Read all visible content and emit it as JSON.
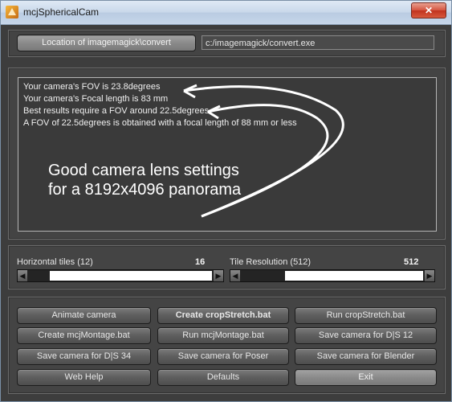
{
  "window": {
    "title": "mcjSphericalCam",
    "close_label": "✕"
  },
  "convert": {
    "button_label": "Location of imagemagick\\convert",
    "path_value": "c:/imagemagick/convert.exe"
  },
  "info": {
    "lines": [
      "Your camera's FOV is 23.8degrees",
      "Your camera's Focal length is 83 mm",
      "Best results require a FOV around 22.5degrees",
      " A FOV of 22.5degrees is obtained with a focal length of 88 mm or less"
    ],
    "annotation": [
      "Good camera lens settings",
      "for a 8192x4096 panorama"
    ]
  },
  "sliders": {
    "horizontal_tiles": {
      "label": "Horizontal tiles (12)",
      "value": "16",
      "fraction": 0.12
    },
    "tile_resolution": {
      "label": "Tile Resolution (512)",
      "value": "512",
      "fraction": 0.25
    }
  },
  "buttons": {
    "animate": "Animate camera",
    "create_crop": "Create cropStretch.bat",
    "run_crop": "Run cropStretch.bat",
    "create_montage": "Create mcjMontage.bat",
    "run_montage": "Run mcjMontage.bat",
    "save_ds12": "Save camera for D|S 12",
    "save_ds34": "Save camera for D|S 34",
    "save_poser": "Save camera for Poser",
    "save_blender": "Save camera for Blender",
    "web_help": "Web Help",
    "defaults": "Defaults",
    "exit": "Exit"
  },
  "colors": {
    "window_bg": "#3d3d3d",
    "panel_bg": "#444444",
    "text": "#f0f0f0",
    "close": "#c0321f"
  }
}
